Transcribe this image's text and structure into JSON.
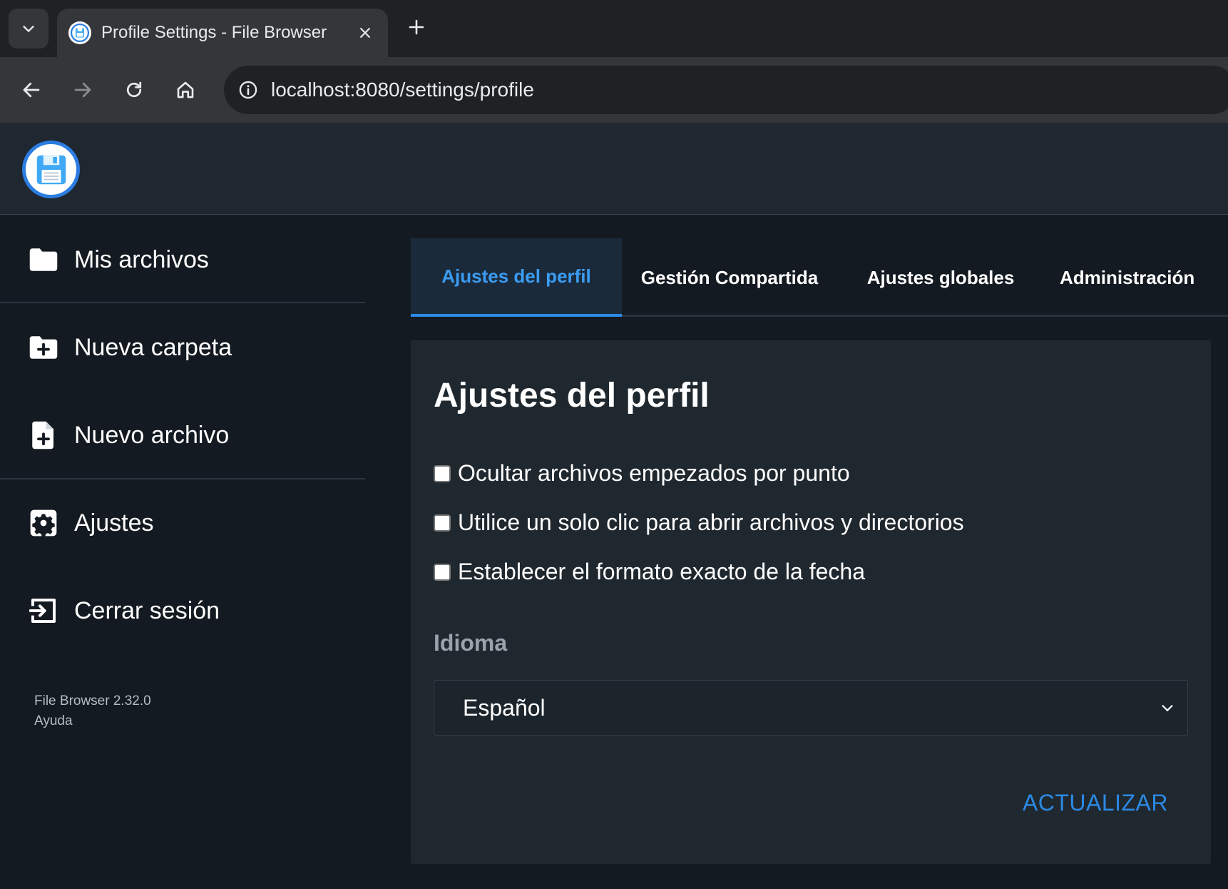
{
  "browser": {
    "tab_title": "Profile Settings - File Browser",
    "url_host": "localhost",
    "url_path": ":8080/settings/profile"
  },
  "sidebar": {
    "items": [
      {
        "label": "Mis archivos",
        "icon": "folder-icon"
      },
      {
        "label": "Nueva carpeta",
        "icon": "folder-plus-icon"
      },
      {
        "label": "Nuevo archivo",
        "icon": "file-plus-icon"
      },
      {
        "label": "Ajustes",
        "icon": "gear-icon"
      },
      {
        "label": "Cerrar sesión",
        "icon": "logout-icon"
      }
    ],
    "footer": {
      "version": "File Browser 2.32.0",
      "help": "Ayuda"
    }
  },
  "settings_tabs": [
    {
      "label": "Ajustes del perfil",
      "active": true
    },
    {
      "label": "Gestión Compartida",
      "active": false
    },
    {
      "label": "Ajustes globales",
      "active": false
    },
    {
      "label": "Administración",
      "active": false
    }
  ],
  "profile": {
    "title": "Ajustes del perfil",
    "checkboxes": [
      {
        "label": "Ocultar archivos empezados por punto",
        "checked": false
      },
      {
        "label": "Utilice un solo clic para abrir archivos y directorios",
        "checked": false
      },
      {
        "label": "Establecer el formato exacto de la fecha",
        "checked": false
      }
    ],
    "language_label": "Idioma",
    "language_value": "Español",
    "update_button": "ACTUALIZAR"
  },
  "colors": {
    "accent": "#2b8ae6",
    "background": "#141a21",
    "card": "#20282f"
  }
}
